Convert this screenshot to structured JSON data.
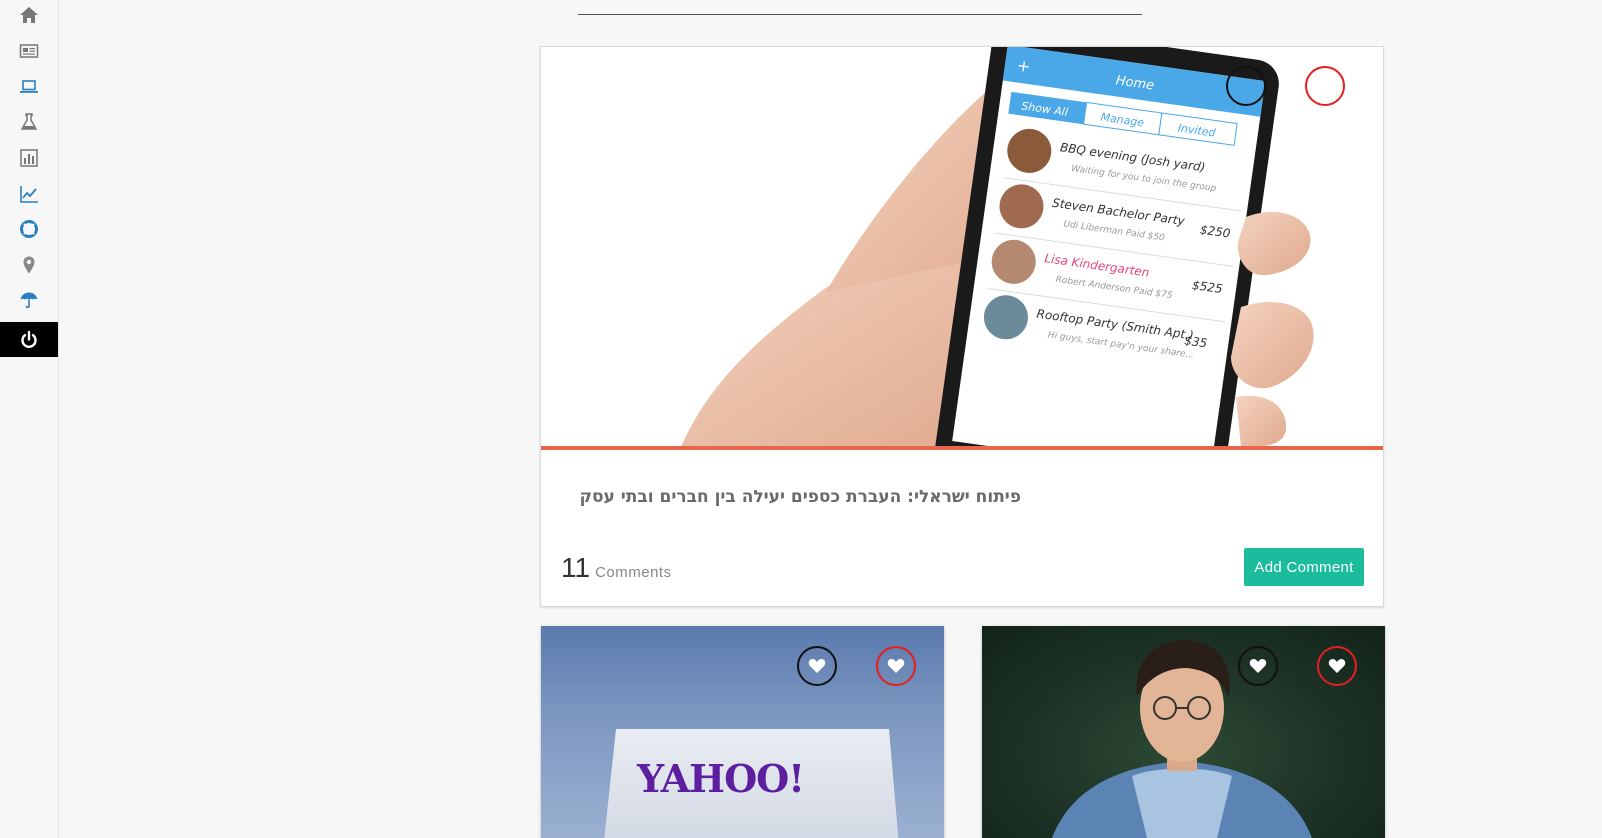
{
  "sidebar": {
    "items": [
      {
        "icon": "home-icon",
        "active": false
      },
      {
        "icon": "newspaper-icon",
        "active": false
      },
      {
        "icon": "laptop-icon",
        "active": false
      },
      {
        "icon": "flask-icon",
        "active": false
      },
      {
        "icon": "bar-chart-icon",
        "active": false
      },
      {
        "icon": "line-chart-icon",
        "active": false
      },
      {
        "icon": "lifebuoy-icon",
        "active": false
      },
      {
        "icon": "map-marker-icon",
        "active": false
      },
      {
        "icon": "umbrella-icon",
        "active": false
      },
      {
        "icon": "power-icon",
        "active": true
      }
    ]
  },
  "featured": {
    "title": "פיתוח ישראלי: העברת כספים יעילה בין חברים ובתי עסק",
    "comment_count": "11",
    "comment_label": "Comments",
    "add_comment_label": "Add Comment",
    "phone": {
      "header": "Home",
      "tabs": [
        "Show All",
        "Manage",
        "Invited"
      ],
      "rows": [
        {
          "title": "BBQ evening (Josh yard)",
          "sub": "Waiting for you to join the group",
          "amount": ""
        },
        {
          "title": "Steven Bachelor Party",
          "sub": "Udi Liberman Paid $50",
          "amount": "$250"
        },
        {
          "title": "Lisa Kindergarten",
          "sub": "Robert Anderson Paid $75",
          "amount": "$525"
        },
        {
          "title": "Rooftop Party (Smith Apt.)",
          "sub": "Hi guys, start pay'n your share...",
          "amount": "$35"
        }
      ]
    }
  },
  "cards": [
    {
      "name": "yahoo",
      "logo_text": "YAHOO!"
    },
    {
      "name": "person"
    }
  ],
  "colors": {
    "accent": "#e8664d",
    "button": "#1abc9c",
    "icon_blue": "#2a7fc0",
    "ring_red": "#e61e1e"
  }
}
